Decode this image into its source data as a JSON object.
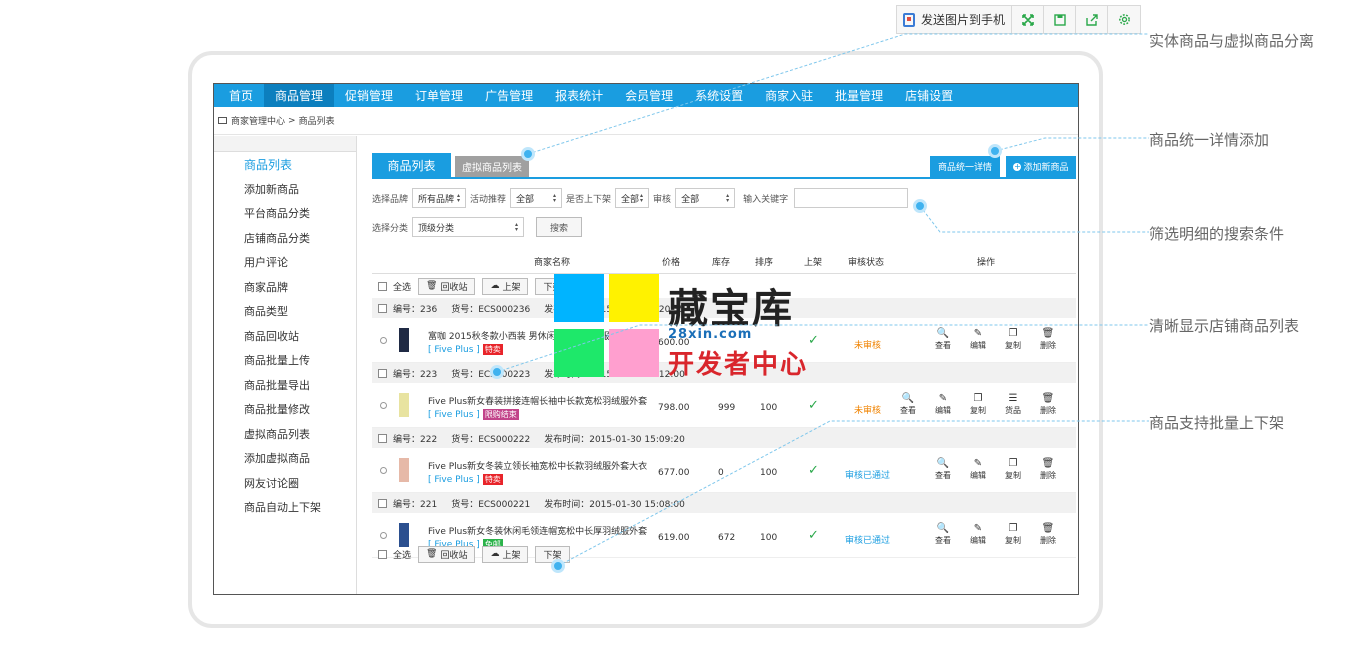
{
  "toolbar": {
    "send_label": "发送图片到手机",
    "icons": [
      "fullscreen-icon",
      "save-icon",
      "share-icon",
      "settings-icon"
    ]
  },
  "nav": [
    "首页",
    "商品管理",
    "促销管理",
    "订单管理",
    "广告管理",
    "报表统计",
    "会员管理",
    "系统设置",
    "商家入驻",
    "批量管理",
    "店铺设置"
  ],
  "nav_active": 1,
  "breadcrumb": {
    "home": "商家管理中心",
    "sep": ">",
    "current": "商品列表"
  },
  "sidebar": [
    "商品列表",
    "添加新商品",
    "平台商品分类",
    "店铺商品分类",
    "用户评论",
    "商家品牌",
    "商品类型",
    "商品回收站",
    "商品批量上传",
    "商品批量导出",
    "商品批量修改",
    "虚拟商品列表",
    "添加虚拟商品",
    "网友讨论圈",
    "商品自动上下架"
  ],
  "tabs": {
    "list": "商品列表",
    "virtual": "虚拟商品列表",
    "unified": "商品统一详情",
    "add": "添加新商品"
  },
  "filters": {
    "brand_label": "选择品牌",
    "brand_value": "所有品牌",
    "promo_label": "活动推荐",
    "promo_value": "全部",
    "onsale_label": "是否上下架",
    "onsale_value": "全部",
    "review_label": "审核",
    "review_value": "全部",
    "keyword_label": "输入关键字",
    "category_label": "选择分类",
    "category_value": "顶级分类",
    "search_label": "搜索"
  },
  "table": {
    "headers": {
      "name": "商家名称",
      "price": "价格",
      "stock": "库存",
      "sort": "排序",
      "onsale": "上架",
      "review": "审核状态",
      "ops": "操作"
    },
    "bulk": {
      "select_all": "全选",
      "recycle": "回收站",
      "up": "上架",
      "down": "下架"
    },
    "groups": [
      {
        "id_text": "编号：236",
        "sn_text": "货号：ECS000236",
        "time_text": "发布时间：2015-01-30 15:20:35",
        "name": "富咖 2015秋冬款小西装 男休闲韩版修身西服外套",
        "brand": "[ Five Plus ]",
        "badge": "特卖",
        "badge_color": "#e8242a",
        "price": "600.00",
        "stock": "",
        "sort": "",
        "review": "未审核",
        "review_type": "pending",
        "ops": [
          "查看",
          "编辑",
          "复制",
          "删除"
        ]
      },
      {
        "id_text": "编号：223",
        "sn_text": "货号：ECS000223",
        "time_text": "发布时间：2015-01-30 15:12:00",
        "name": "Five Plus新女春装拼接连帽长袖中长款宽松羽绒服外套...",
        "brand": "[ Five Plus ]",
        "badge": "限购结束",
        "badge_color": "#c2448a",
        "price": "798.00",
        "stock": "999",
        "sort": "100",
        "review": "未审核",
        "review_type": "pending",
        "ops": [
          "查看",
          "编辑",
          "复制",
          "货品",
          "删除"
        ]
      },
      {
        "id_text": "编号：222",
        "sn_text": "货号：ECS000222",
        "time_text": "发布时间：2015-01-30 15:09:20",
        "name": "Five Plus新女冬装立领长袖宽松中长款羽绒服外套大衣...",
        "brand": "[ Five Plus ]",
        "badge": "特卖",
        "badge_color": "#e8242a",
        "price": "677.00",
        "stock": "0",
        "sort": "100",
        "review": "审核已通过",
        "review_type": "passed",
        "ops": [
          "查看",
          "编辑",
          "复制",
          "删除"
        ]
      },
      {
        "id_text": "编号：221",
        "sn_text": "货号：ECS000221",
        "time_text": "发布时间：2015-01-30 15:08:00",
        "name": "Five Plus新女冬装休闲毛领连帽宽松中长厚羽绒服外套...",
        "brand": "[ Five Plus ]",
        "badge": "免邮",
        "badge_color": "#2bb34a",
        "price": "619.00",
        "stock": "672",
        "sort": "100",
        "review": "审核已通过",
        "review_type": "passed",
        "ops": [
          "查看",
          "编辑",
          "复制",
          "删除"
        ]
      }
    ]
  },
  "watermark": {
    "title": "藏宝库",
    "url": "28xin.com",
    "subtitle": "开发者中心",
    "colors": [
      "#00b4ff",
      "#fff200",
      "#1ee86a",
      "#ff9fcf"
    ]
  },
  "annotations": [
    "实体商品与虚拟商品分离",
    "商品统一详情添加",
    "筛选明细的搜索条件",
    "清晰显示店铺商品列表",
    "商品支持批量上下架"
  ],
  "colors": {
    "accent": "#1a9de0",
    "pending": "#f08300",
    "ok": "#2aa84a"
  }
}
